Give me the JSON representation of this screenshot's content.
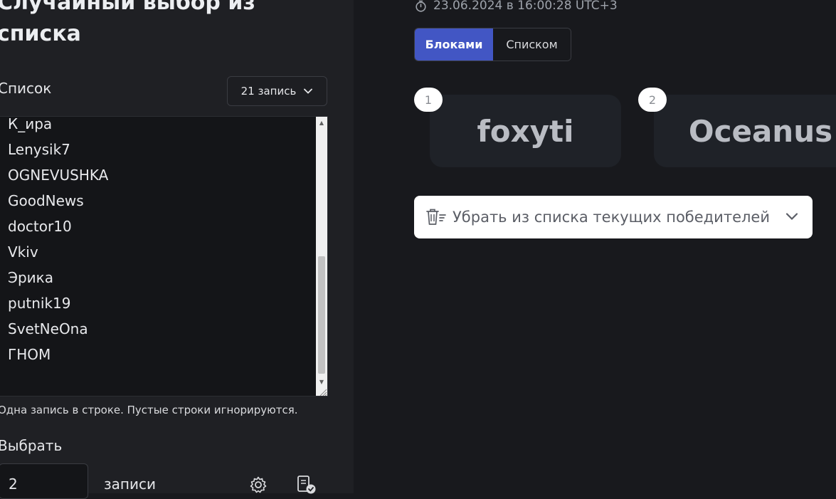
{
  "left_panel": {
    "title": "Случайный выбор из списка",
    "list_label": "Список",
    "count_dropdown": {
      "value": "21 запись",
      "icon": "chevron-down-icon"
    },
    "list_lines": [
      "К_ира",
      "Lenysik7",
      "OGNEVUSHKA",
      "GoodNews",
      "doctor10",
      "Vkiv",
      "Эрика",
      "putnik19",
      "SvetNeOna",
      "ГНОМ"
    ],
    "list_hint": "Одна запись в строке. Пустые строки игнорируются.",
    "pick_label": "Выбрать",
    "pick_count": "2",
    "pick_unit": "записи",
    "icons": [
      "settings-icon",
      "checklist-icon"
    ]
  },
  "right_panel": {
    "timestamp": "23.06.2024 в 16:00:28 UTC+3",
    "timestamp_icon": "stopwatch-icon",
    "view_toggle": {
      "blocks": "Блоками",
      "list": "Списком",
      "active": "blocks"
    },
    "winners": [
      {
        "badge": "1",
        "name": "foxyti"
      },
      {
        "badge": "2",
        "name": "Oceanus"
      }
    ],
    "remove_winners": {
      "label": "Убрать из списка текущих победителей",
      "icon": "trash-list-icon"
    }
  },
  "colors": {
    "accent": "#4256c4",
    "background": "#18191d",
    "panel": "#1f2024",
    "card": "#1f2228"
  }
}
